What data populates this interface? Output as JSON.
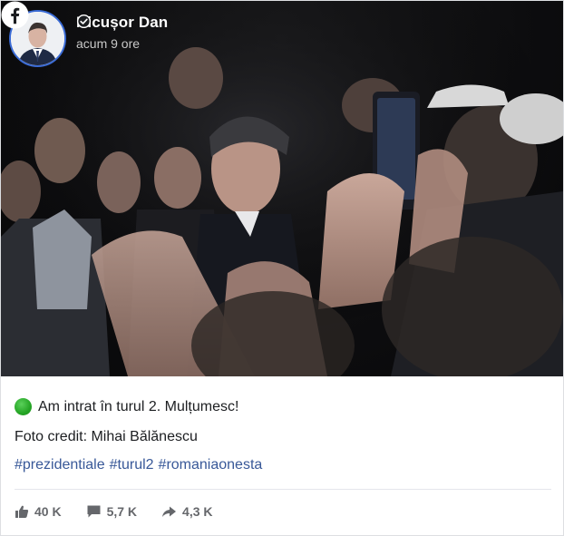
{
  "post": {
    "author": "Nicușor Dan",
    "timestamp": "acum 9 ore",
    "text_line1": "Am intrat în turul 2. Mulțumesc!",
    "text_line2": "Foto credit: Mihai Bălănescu",
    "hashtags": [
      "#prezidentiale",
      "#turul2",
      "#romaniaonesta"
    ]
  },
  "stats": {
    "likes": "40 K",
    "comments": "5,7 K",
    "shares": "4,3 K"
  },
  "icons": {
    "brand": "facebook-icon",
    "verified": "verified-badge-icon",
    "status": "green-circle-emoji"
  },
  "colors": {
    "hashtag": "#385898",
    "verified": "#1877f2",
    "avatar_ring": "#3a6bd6",
    "stat_text": "#65676b"
  }
}
